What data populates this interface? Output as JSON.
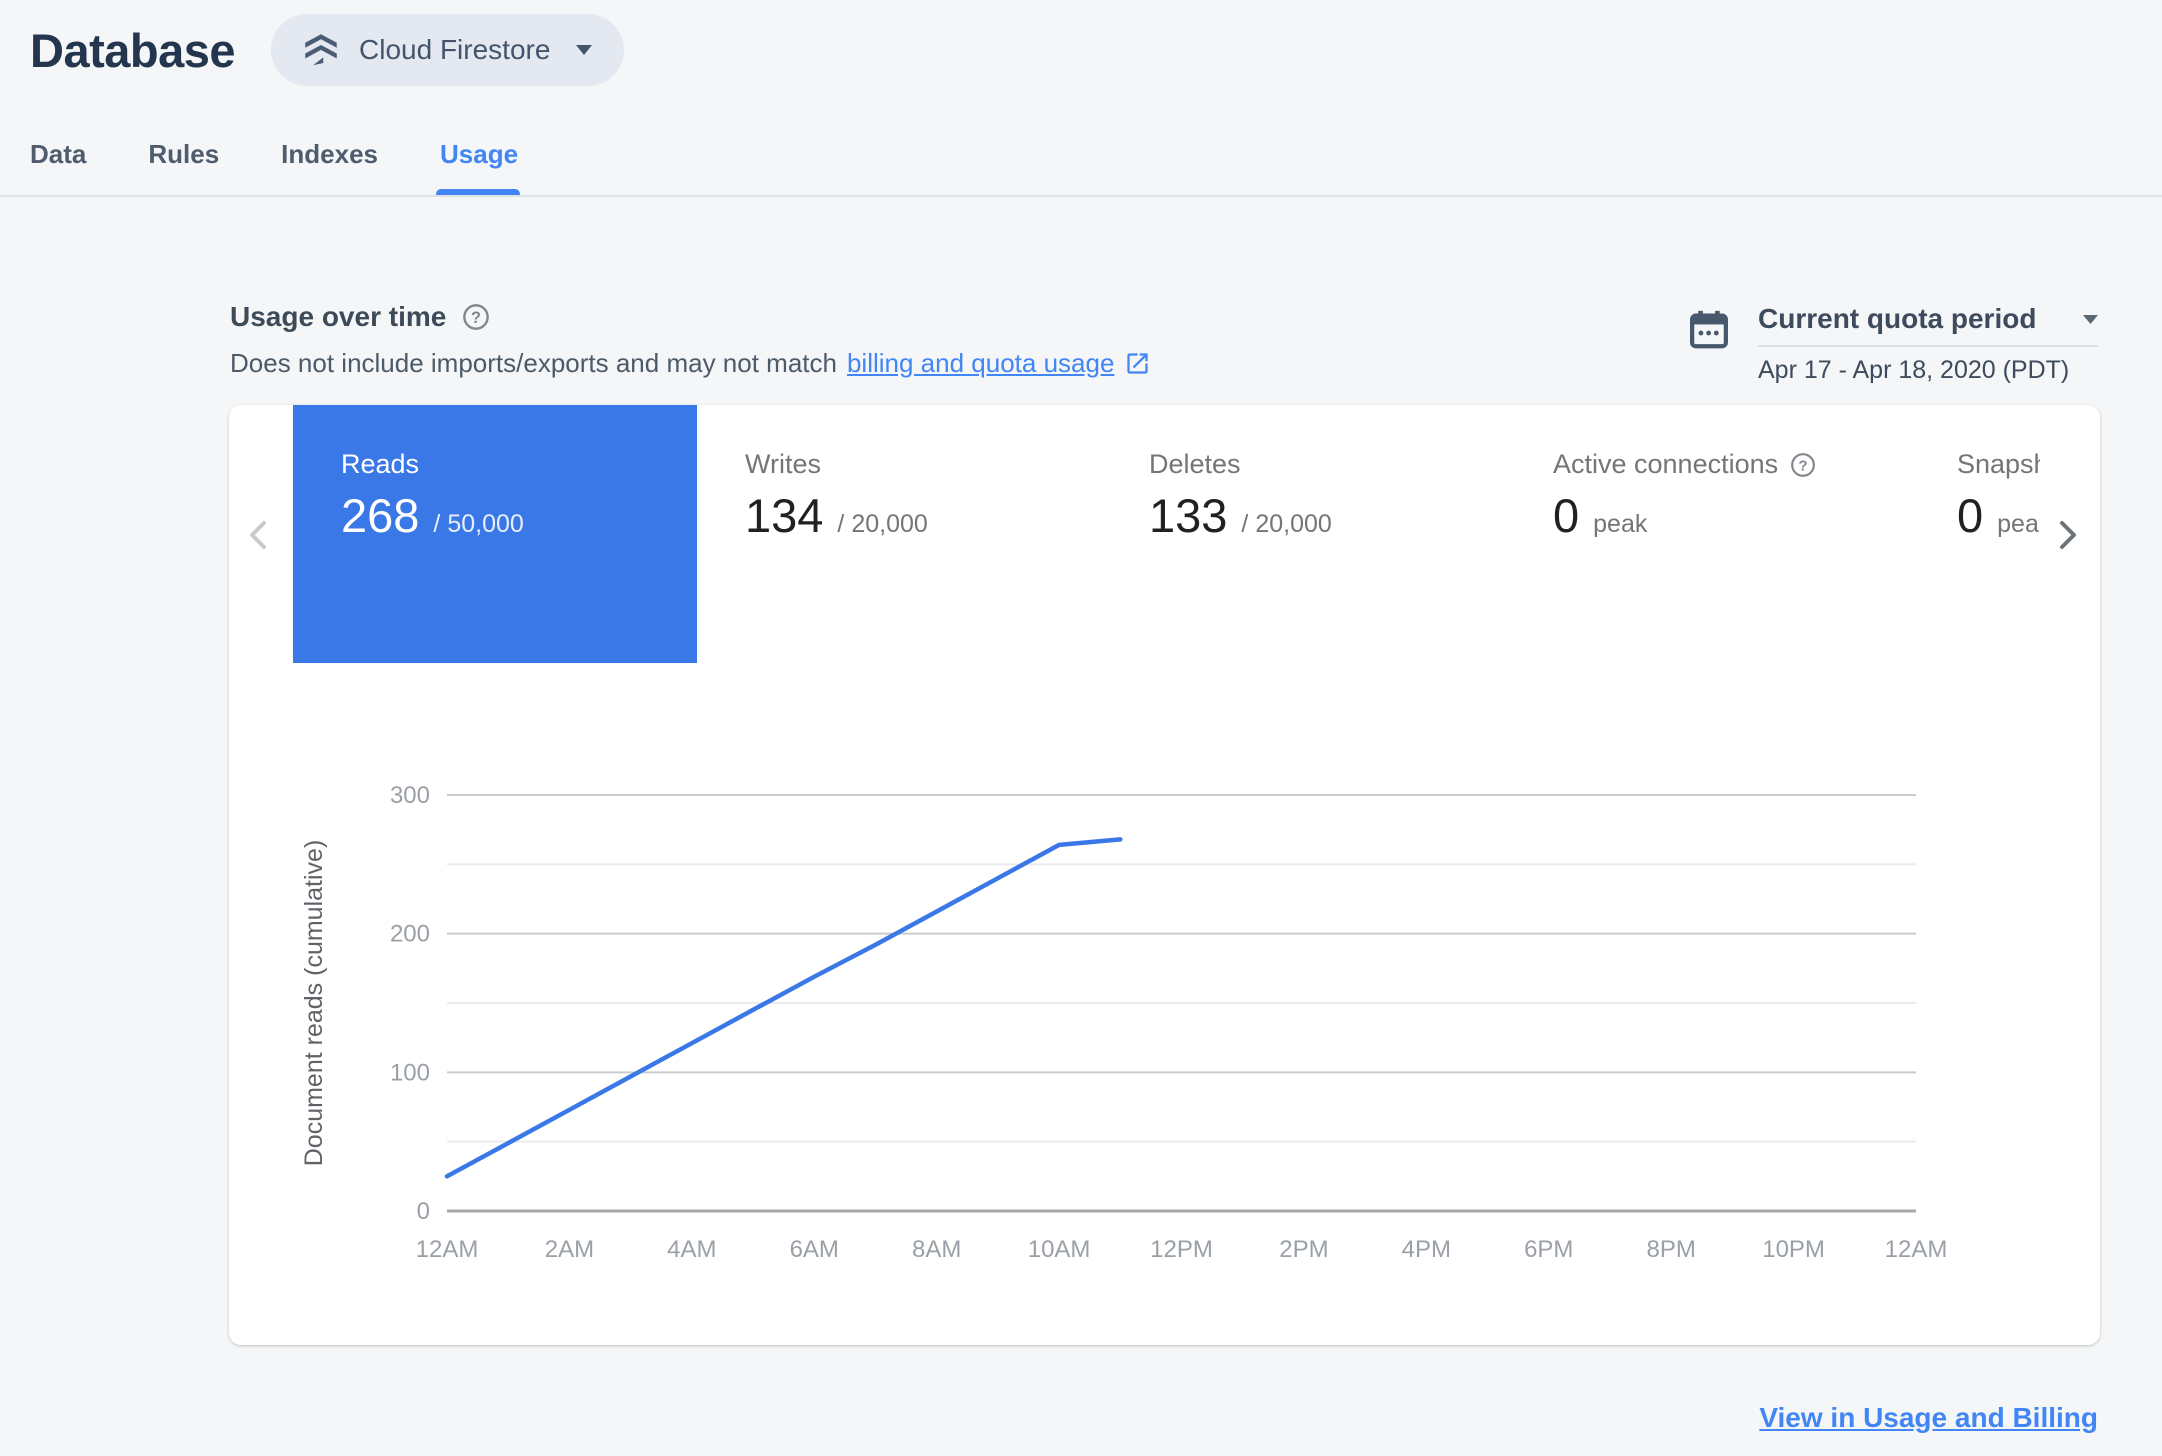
{
  "header": {
    "title": "Database",
    "product": "Cloud Firestore"
  },
  "tabs": [
    "Data",
    "Rules",
    "Indexes",
    "Usage"
  ],
  "usage": {
    "heading": "Usage over time",
    "desc_prefix": "Does not include imports/exports and may not match",
    "desc_link": "billing and quota usage",
    "period_label": "Current quota period",
    "period_value": "Apr 17 - Apr 18, 2020 (PDT)"
  },
  "metrics": [
    {
      "label": "Reads",
      "value": "268",
      "suffix": "/ 50,000"
    },
    {
      "label": "Writes",
      "value": "134",
      "suffix": "/ 20,000"
    },
    {
      "label": "Deletes",
      "value": "133",
      "suffix": "/ 20,000"
    },
    {
      "label": "Active connections",
      "value": "0",
      "suffix": "peak"
    },
    {
      "label": "Snapshot listeners",
      "value": "0",
      "suffix": "peak"
    }
  ],
  "chart_data": {
    "type": "line",
    "ylabel": "Document reads (cumulative)",
    "ylim": [
      0,
      300
    ],
    "yticks": [
      0,
      100,
      200,
      300
    ],
    "grid_minor": [
      50,
      150,
      250
    ],
    "xlim_hours": [
      0,
      24
    ],
    "xtick_hours": [
      0,
      2,
      4,
      6,
      8,
      10,
      12,
      14,
      16,
      18,
      20,
      22,
      24
    ],
    "xtick_labels": [
      "12AM",
      "2AM",
      "4AM",
      "6AM",
      "8AM",
      "10AM",
      "12PM",
      "2PM",
      "4PM",
      "6PM",
      "8PM",
      "10PM",
      "12AM"
    ],
    "series": [
      {
        "name": "Document reads (cumulative)",
        "x": [
          0,
          1,
          2,
          3,
          4,
          5,
          6,
          7,
          8,
          9,
          10,
          11
        ],
        "values": [
          25,
          49,
          73,
          97,
          121,
          145,
          169,
          192,
          216,
          240,
          264,
          268
        ]
      }
    ],
    "legend": "off",
    "grid": "on",
    "line_color": "#3b78e7",
    "tick_color": "#9aa0a6",
    "axis_title_color": "#5f6368",
    "grid_major_color": "#c9ccce",
    "grid_minor_color": "#e9ebec",
    "baseline_color": "#a6a8ab"
  },
  "footer_link": "View in Usage and Billing",
  "colors": {
    "accent_blue": "#4285f4",
    "selected_tile_blue": "#3b78e7",
    "slate": "#47586d",
    "page_background": "#f4f6f8"
  }
}
